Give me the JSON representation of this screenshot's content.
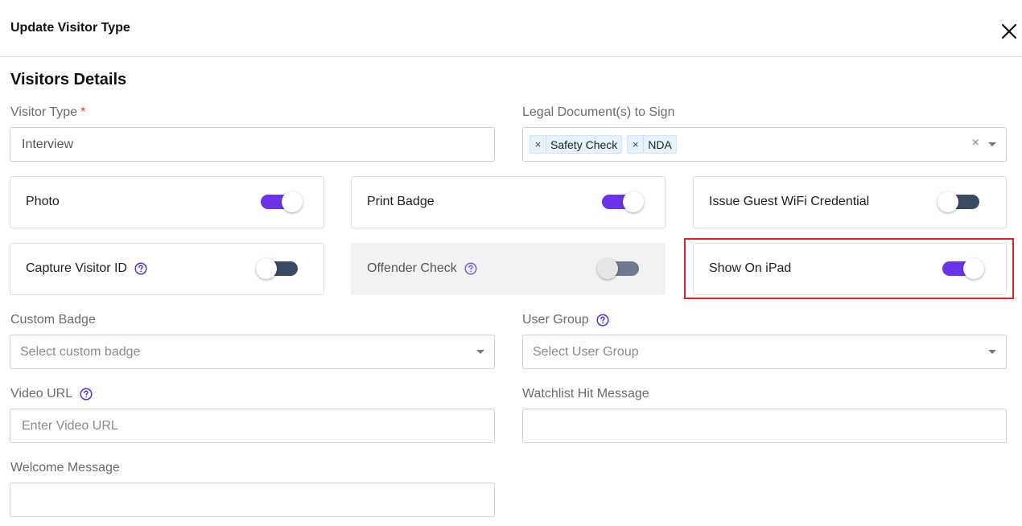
{
  "header": {
    "title": "Update Visitor Type"
  },
  "section": {
    "title": "Visitors Details"
  },
  "visitor_type": {
    "label": "Visitor Type",
    "required_mark": "*",
    "value": "Interview"
  },
  "legal_docs": {
    "label": "Legal Document(s) to Sign",
    "tags": [
      "Safety Check",
      "NDA"
    ],
    "tag_remove": "×",
    "clear": "×"
  },
  "toggles": {
    "photo": {
      "label": "Photo",
      "state": "on"
    },
    "print_badge": {
      "label": "Print Badge",
      "state": "on"
    },
    "guest_wifi": {
      "label": "Issue Guest WiFi Credential",
      "state": "off"
    },
    "capture_id": {
      "label": "Capture Visitor ID",
      "state": "off"
    },
    "offender_check": {
      "label": "Offender Check",
      "state": "off",
      "disabled": true
    },
    "show_on_ipad": {
      "label": "Show On iPad",
      "state": "on",
      "highlighted": true
    }
  },
  "custom_badge": {
    "label": "Custom Badge",
    "placeholder": "Select custom badge"
  },
  "user_group": {
    "label": "User Group",
    "placeholder": "Select User Group"
  },
  "video_url": {
    "label": "Video URL",
    "placeholder": "Enter Video URL"
  },
  "watchlist": {
    "label": "Watchlist Hit Message",
    "value": ""
  },
  "welcome": {
    "label": "Welcome Message",
    "value": ""
  },
  "colors": {
    "accent": "#6a34e8",
    "toggle_off": "#3b4a63",
    "highlight": "#e02424",
    "required": "#e53935"
  },
  "icons": {
    "close": "close-icon",
    "help": "question-circle-icon",
    "dropdown": "chevron-down-icon"
  }
}
